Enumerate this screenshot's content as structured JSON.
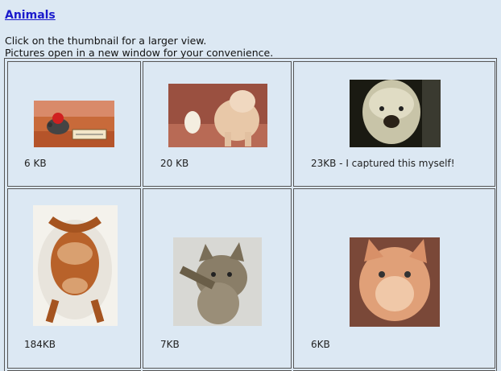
{
  "page": {
    "title": "Animals",
    "intro_line1": "Click on the thumbnail for a larger view.",
    "intro_line2": "Pictures open in a new window for your convenience."
  },
  "gallery": {
    "items": [
      {
        "caption": "6 KB",
        "icon": "mouse-trap-photo"
      },
      {
        "caption": "20 KB",
        "icon": "shar-pei-dog-photo"
      },
      {
        "caption": "23KB - I captured this myself!",
        "icon": "shaggy-dog-photo"
      },
      {
        "caption": "184KB",
        "icon": "roast-chicken-bikini-photo"
      },
      {
        "caption": "7KB",
        "icon": "tabby-cat-photo"
      },
      {
        "caption": "6KB",
        "icon": "orange-kitten-photo"
      }
    ]
  }
}
